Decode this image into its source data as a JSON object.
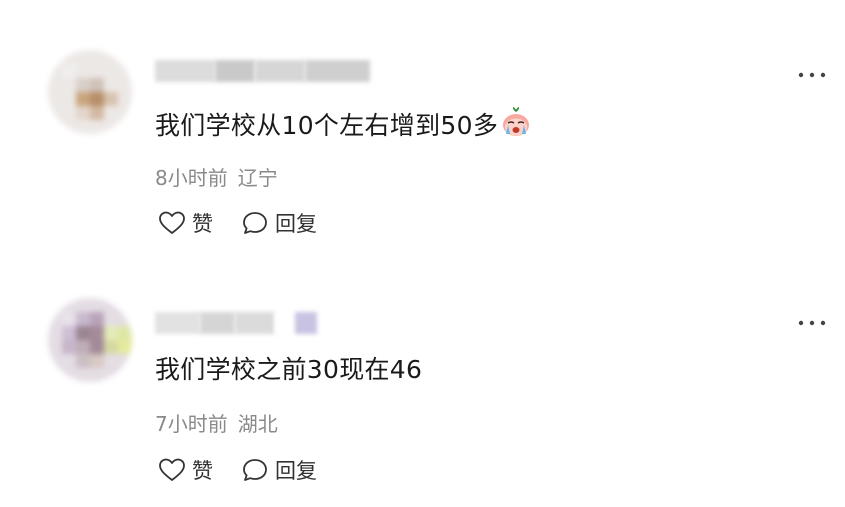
{
  "comments": [
    {
      "username_redacted": true,
      "text": "我们学校从10个左右增到50多",
      "emoji": "crying-face-emoji",
      "time": "8小时前",
      "location": "辽宁",
      "like_label": "赞",
      "reply_label": "回复",
      "more_icon": "more-dots-icon"
    },
    {
      "username_redacted": true,
      "text": "我们学校之前30现在46",
      "time": "7小时前",
      "location": "湖北",
      "like_label": "赞",
      "reply_label": "回复",
      "more_icon": "more-dots-icon"
    }
  ],
  "icons": {
    "like": "heart-icon",
    "reply": "speech-bubble-icon"
  },
  "colors": {
    "text": "#1a1a1a",
    "meta": "#8a8a8a",
    "action": "#333333"
  }
}
